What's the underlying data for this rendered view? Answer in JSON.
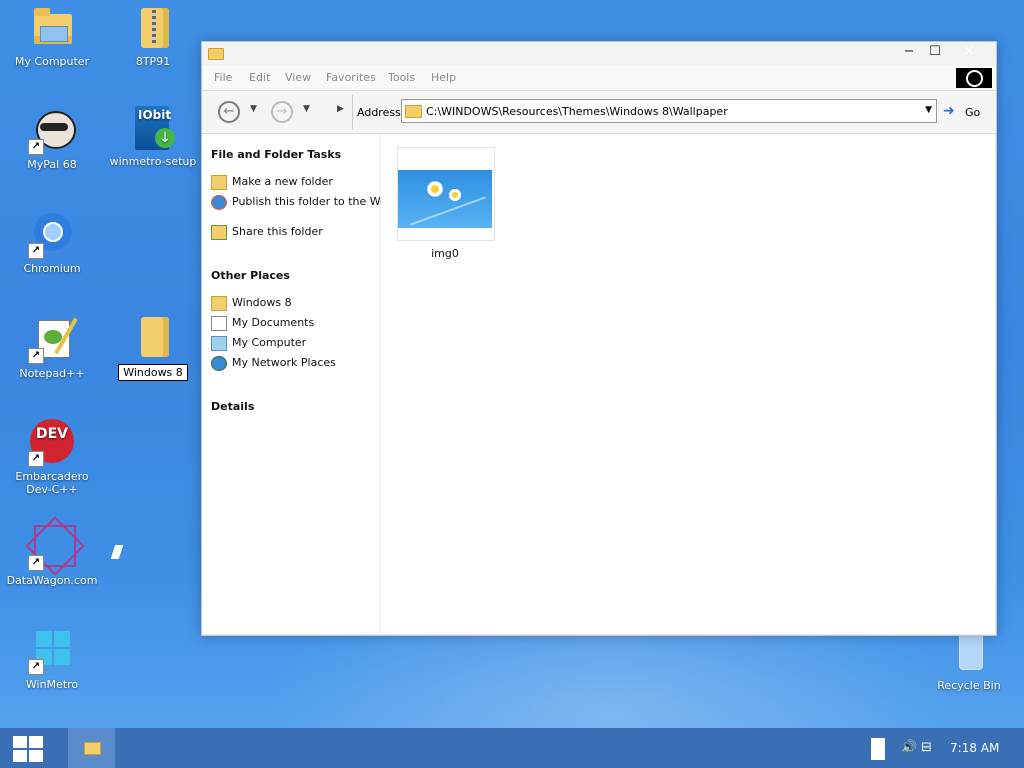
{
  "desktop": {
    "icons": [
      {
        "label": "My Computer"
      },
      {
        "label": "8TP91"
      },
      {
        "label": "MyPal 68"
      },
      {
        "label": "winmetro-setup"
      },
      {
        "label": "Chromium"
      },
      {
        "label": "Notepad++"
      },
      {
        "label": "Windows 8"
      },
      {
        "label": "Embarcadero Dev-C++"
      },
      {
        "label": "DataWagon.com"
      },
      {
        "label": "WinMetro"
      },
      {
        "label": "Recycle Bin"
      }
    ]
  },
  "window": {
    "menu": [
      "File",
      "Edit",
      "View",
      "Favorites",
      "Tools",
      "Help"
    ],
    "address_label": "Address",
    "address_value": "C:\\WINDOWS\\Resources\\Themes\\Windows 8\\Wallpaper",
    "go_label": "Go",
    "sidebar": {
      "tasks_header": "File and Folder Tasks",
      "tasks": [
        "Make a new folder",
        "Publish this folder to the Web",
        "Share this folder"
      ],
      "places_header": "Other Places",
      "places": [
        "Windows 8",
        "My Documents",
        "My Computer",
        "My Network Places"
      ],
      "details_header": "Details"
    },
    "files": [
      {
        "name": "img0"
      }
    ]
  },
  "taskbar": {
    "clock": "7:18 AM"
  },
  "colors": {
    "desktop": "#3b86e0",
    "taskbar": "#3a6fb5",
    "folder": "#f2cf6a"
  }
}
